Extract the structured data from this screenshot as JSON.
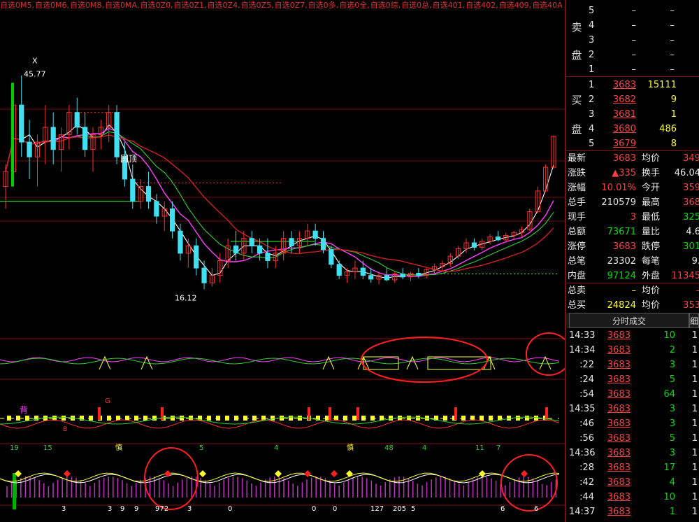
{
  "top_tabs": [
    "自选0M5",
    "自选0M6",
    "自选0M8",
    "自选0MA",
    "自选0Z0",
    "自选0Z1",
    "自选0Z4",
    "自选0Z5",
    "自选0Z7",
    "自选0多",
    "自选0全",
    "自选0综",
    "自选0总",
    "自选401",
    "自选402",
    "自选409",
    "自选40A"
  ],
  "chart_data": [
    {
      "type": "candlestick",
      "title": "",
      "annotations": [
        "X",
        "45.77",
        "圆顶",
        "16.12"
      ],
      "high_label": "45.77",
      "low_label": "16.12",
      "round_top_label": "圆顶",
      "x_marker": "X",
      "ohlc": [
        [
          30,
          33,
          27,
          32
        ],
        [
          32,
          44,
          30,
          41
        ],
        [
          41,
          45,
          34,
          36
        ],
        [
          36,
          39,
          31,
          34
        ],
        [
          34,
          37,
          30,
          36
        ],
        [
          36,
          41,
          33,
          38
        ],
        [
          38,
          40,
          33,
          35
        ],
        [
          35,
          38,
          32,
          37
        ],
        [
          37,
          41,
          35,
          40
        ],
        [
          40,
          42,
          37,
          38
        ],
        [
          38,
          40,
          34,
          35
        ],
        [
          35,
          38,
          32,
          37
        ],
        [
          37,
          39,
          35,
          38
        ],
        [
          38,
          41,
          36,
          40
        ],
        [
          40,
          41,
          33,
          34
        ],
        [
          34,
          36,
          30,
          31
        ],
        [
          31,
          33,
          27,
          28
        ],
        [
          28,
          31,
          27,
          30
        ],
        [
          30,
          32,
          27,
          28
        ],
        [
          28,
          29,
          25,
          26
        ],
        [
          26,
          28,
          24,
          27
        ],
        [
          27,
          28,
          23,
          24
        ],
        [
          24,
          25,
          20,
          21
        ],
        [
          21,
          23,
          19,
          22
        ],
        [
          22,
          23,
          18,
          19
        ],
        [
          19,
          20,
          16.12,
          17
        ],
        [
          17,
          19,
          16.5,
          18
        ],
        [
          18,
          21,
          17,
          20
        ],
        [
          20,
          23,
          19,
          22
        ],
        [
          22,
          24,
          20,
          21
        ],
        [
          21,
          24,
          20,
          23
        ],
        [
          23,
          24,
          21,
          22
        ],
        [
          22,
          23,
          20,
          21
        ],
        [
          21,
          23,
          19,
          20
        ],
        [
          20,
          22,
          19,
          21
        ],
        [
          21,
          24,
          20,
          23
        ],
        [
          23,
          24,
          21,
          22
        ],
        [
          22,
          24,
          21,
          23
        ],
        [
          23,
          25,
          22,
          24
        ],
        [
          24,
          25,
          22,
          23
        ],
        [
          23,
          24,
          21,
          21.5
        ],
        [
          21.5,
          22,
          19,
          19.5
        ],
        [
          19.5,
          20,
          17.5,
          18
        ],
        [
          18,
          19,
          17,
          18.5
        ],
        [
          18.5,
          20,
          17.5,
          19
        ],
        [
          19,
          20,
          17.5,
          18
        ],
        [
          18,
          19,
          17,
          17.5
        ],
        [
          17.5,
          18.5,
          16.8,
          18
        ],
        [
          18,
          19,
          17.2,
          17.4
        ],
        [
          17.4,
          18.5,
          17,
          18.2
        ],
        [
          18.2,
          19,
          17.5,
          17.8
        ],
        [
          17.8,
          18.5,
          17.2,
          18.3
        ],
        [
          18.3,
          19,
          17.6,
          18
        ],
        [
          18,
          19,
          17.6,
          18.8
        ],
        [
          18.8,
          19.6,
          18.2,
          19.2
        ],
        [
          19.2,
          20,
          18.6,
          19.6
        ],
        [
          19.6,
          21,
          19.2,
          20.6
        ],
        [
          20.6,
          22,
          20.2,
          21.6
        ],
        [
          21.6,
          23,
          21,
          22.4
        ],
        [
          22.4,
          23,
          21.4,
          21.8
        ],
        [
          21.8,
          23,
          21.4,
          22.6
        ],
        [
          22.6,
          23.6,
          22.2,
          23.2
        ],
        [
          23.2,
          24,
          22.6,
          22.8
        ],
        [
          22.8,
          23.8,
          22.4,
          23.4
        ],
        [
          23.4,
          24,
          22.8,
          23.8
        ],
        [
          23.8,
          24.6,
          23.2,
          24.2
        ],
        [
          24.2,
          27,
          24,
          26.6
        ],
        [
          26.6,
          30,
          26.4,
          29.4
        ],
        [
          29.4,
          33,
          29.2,
          32.6
        ],
        [
          32.6,
          36.8,
          32.4,
          36.8
        ]
      ]
    },
    {
      "type": "line",
      "title": "",
      "note": "indicator panel 1"
    },
    {
      "type": "bar",
      "title": "",
      "labels": [
        "背",
        "G",
        "B"
      ],
      "note": "indicator panel 2"
    },
    {
      "type": "bar",
      "title": "",
      "top_labels": [
        "19",
        "15",
        "慎",
        "5",
        "4",
        "慎",
        "48",
        "4",
        "11",
        "7"
      ],
      "bottom_labels": [
        "3",
        "3",
        "9",
        "9",
        "972",
        "3",
        "0",
        "0",
        "0",
        "127",
        "205",
        "5",
        "6",
        "6"
      ]
    }
  ],
  "order_book": {
    "sell_label_1": "卖",
    "sell_label_2": "盘",
    "buy_label_1": "买",
    "buy_label_2": "盘",
    "asks": [
      {
        "level": "5",
        "price": "–",
        "vol": "–"
      },
      {
        "level": "4",
        "price": "–",
        "vol": "–"
      },
      {
        "level": "3",
        "price": "–",
        "vol": "–"
      },
      {
        "level": "2",
        "price": "–",
        "vol": "–"
      },
      {
        "level": "1",
        "price": "–",
        "vol": "–"
      }
    ],
    "bids": [
      {
        "level": "1",
        "price": "3683",
        "vol": "15111"
      },
      {
        "level": "2",
        "price": "3682",
        "vol": "9"
      },
      {
        "level": "3",
        "price": "3681",
        "vol": "1"
      },
      {
        "level": "4",
        "price": "3680",
        "vol": "486"
      },
      {
        "level": "5",
        "price": "3679",
        "vol": "8"
      }
    ]
  },
  "quote": [
    {
      "l1": "最新",
      "v1": "3683",
      "l2": "均价",
      "v2": "349"
    },
    {
      "l1": "涨跌",
      "v1": "▲335",
      "l2": "换手",
      "v2": "46.04"
    },
    {
      "l1": "涨幅",
      "v1": "10.01%",
      "l2": "今开",
      "v2": "359"
    },
    {
      "l1": "总手",
      "v1": "210579",
      "l2": "最高",
      "v2": "368"
    },
    {
      "l1": "现手",
      "v1": "3",
      "l2": "最低",
      "v2": "325"
    },
    {
      "l1": "总额",
      "v1": "73671",
      "l2": "量比",
      "v2": "4.6"
    },
    {
      "l1": "涨停",
      "v1": "3683",
      "l2": "跌停",
      "v2": "301"
    },
    {
      "l1": "总笔",
      "v1": "23302",
      "l2": "每笔",
      "v2": "9."
    },
    {
      "l1": "内盘",
      "v1": "97124",
      "l2": "外盘",
      "v2": "11345"
    }
  ],
  "totals": [
    {
      "l1": "总卖",
      "v1": "–",
      "l2": "均价",
      "v2": "–"
    },
    {
      "l1": "总买",
      "v1": "24824",
      "l2": "均价",
      "v2": "353"
    }
  ],
  "tabs": {
    "ticks": "分时成交",
    "detail": "细"
  },
  "ticks": [
    {
      "time": "14:33",
      "price": "3683",
      "vol": "10",
      "n": "1"
    },
    {
      "time": "14:34",
      "price": "3683",
      "vol": "2",
      "n": "1"
    },
    {
      "time": ":22",
      "price": "3683",
      "vol": "3",
      "n": "1"
    },
    {
      "time": ":24",
      "price": "3683",
      "vol": "5",
      "n": "1"
    },
    {
      "time": ":54",
      "price": "3683",
      "vol": "64",
      "n": "1"
    },
    {
      "time": "14:35",
      "price": "3683",
      "vol": "3",
      "n": "1"
    },
    {
      "time": ":46",
      "price": "3683",
      "vol": "3",
      "n": "1"
    },
    {
      "time": ":56",
      "price": "3683",
      "vol": "5",
      "n": "1"
    },
    {
      "time": "14:36",
      "price": "3683",
      "vol": "3",
      "n": "1"
    },
    {
      "time": ":28",
      "price": "3683",
      "vol": "17",
      "n": "1"
    },
    {
      "time": ":42",
      "price": "3683",
      "vol": "4",
      "n": "1"
    },
    {
      "time": ":44",
      "price": "3683",
      "vol": "10",
      "n": "1"
    },
    {
      "time": "14:37",
      "price": "3683",
      "vol": "1",
      "n": "1"
    }
  ]
}
